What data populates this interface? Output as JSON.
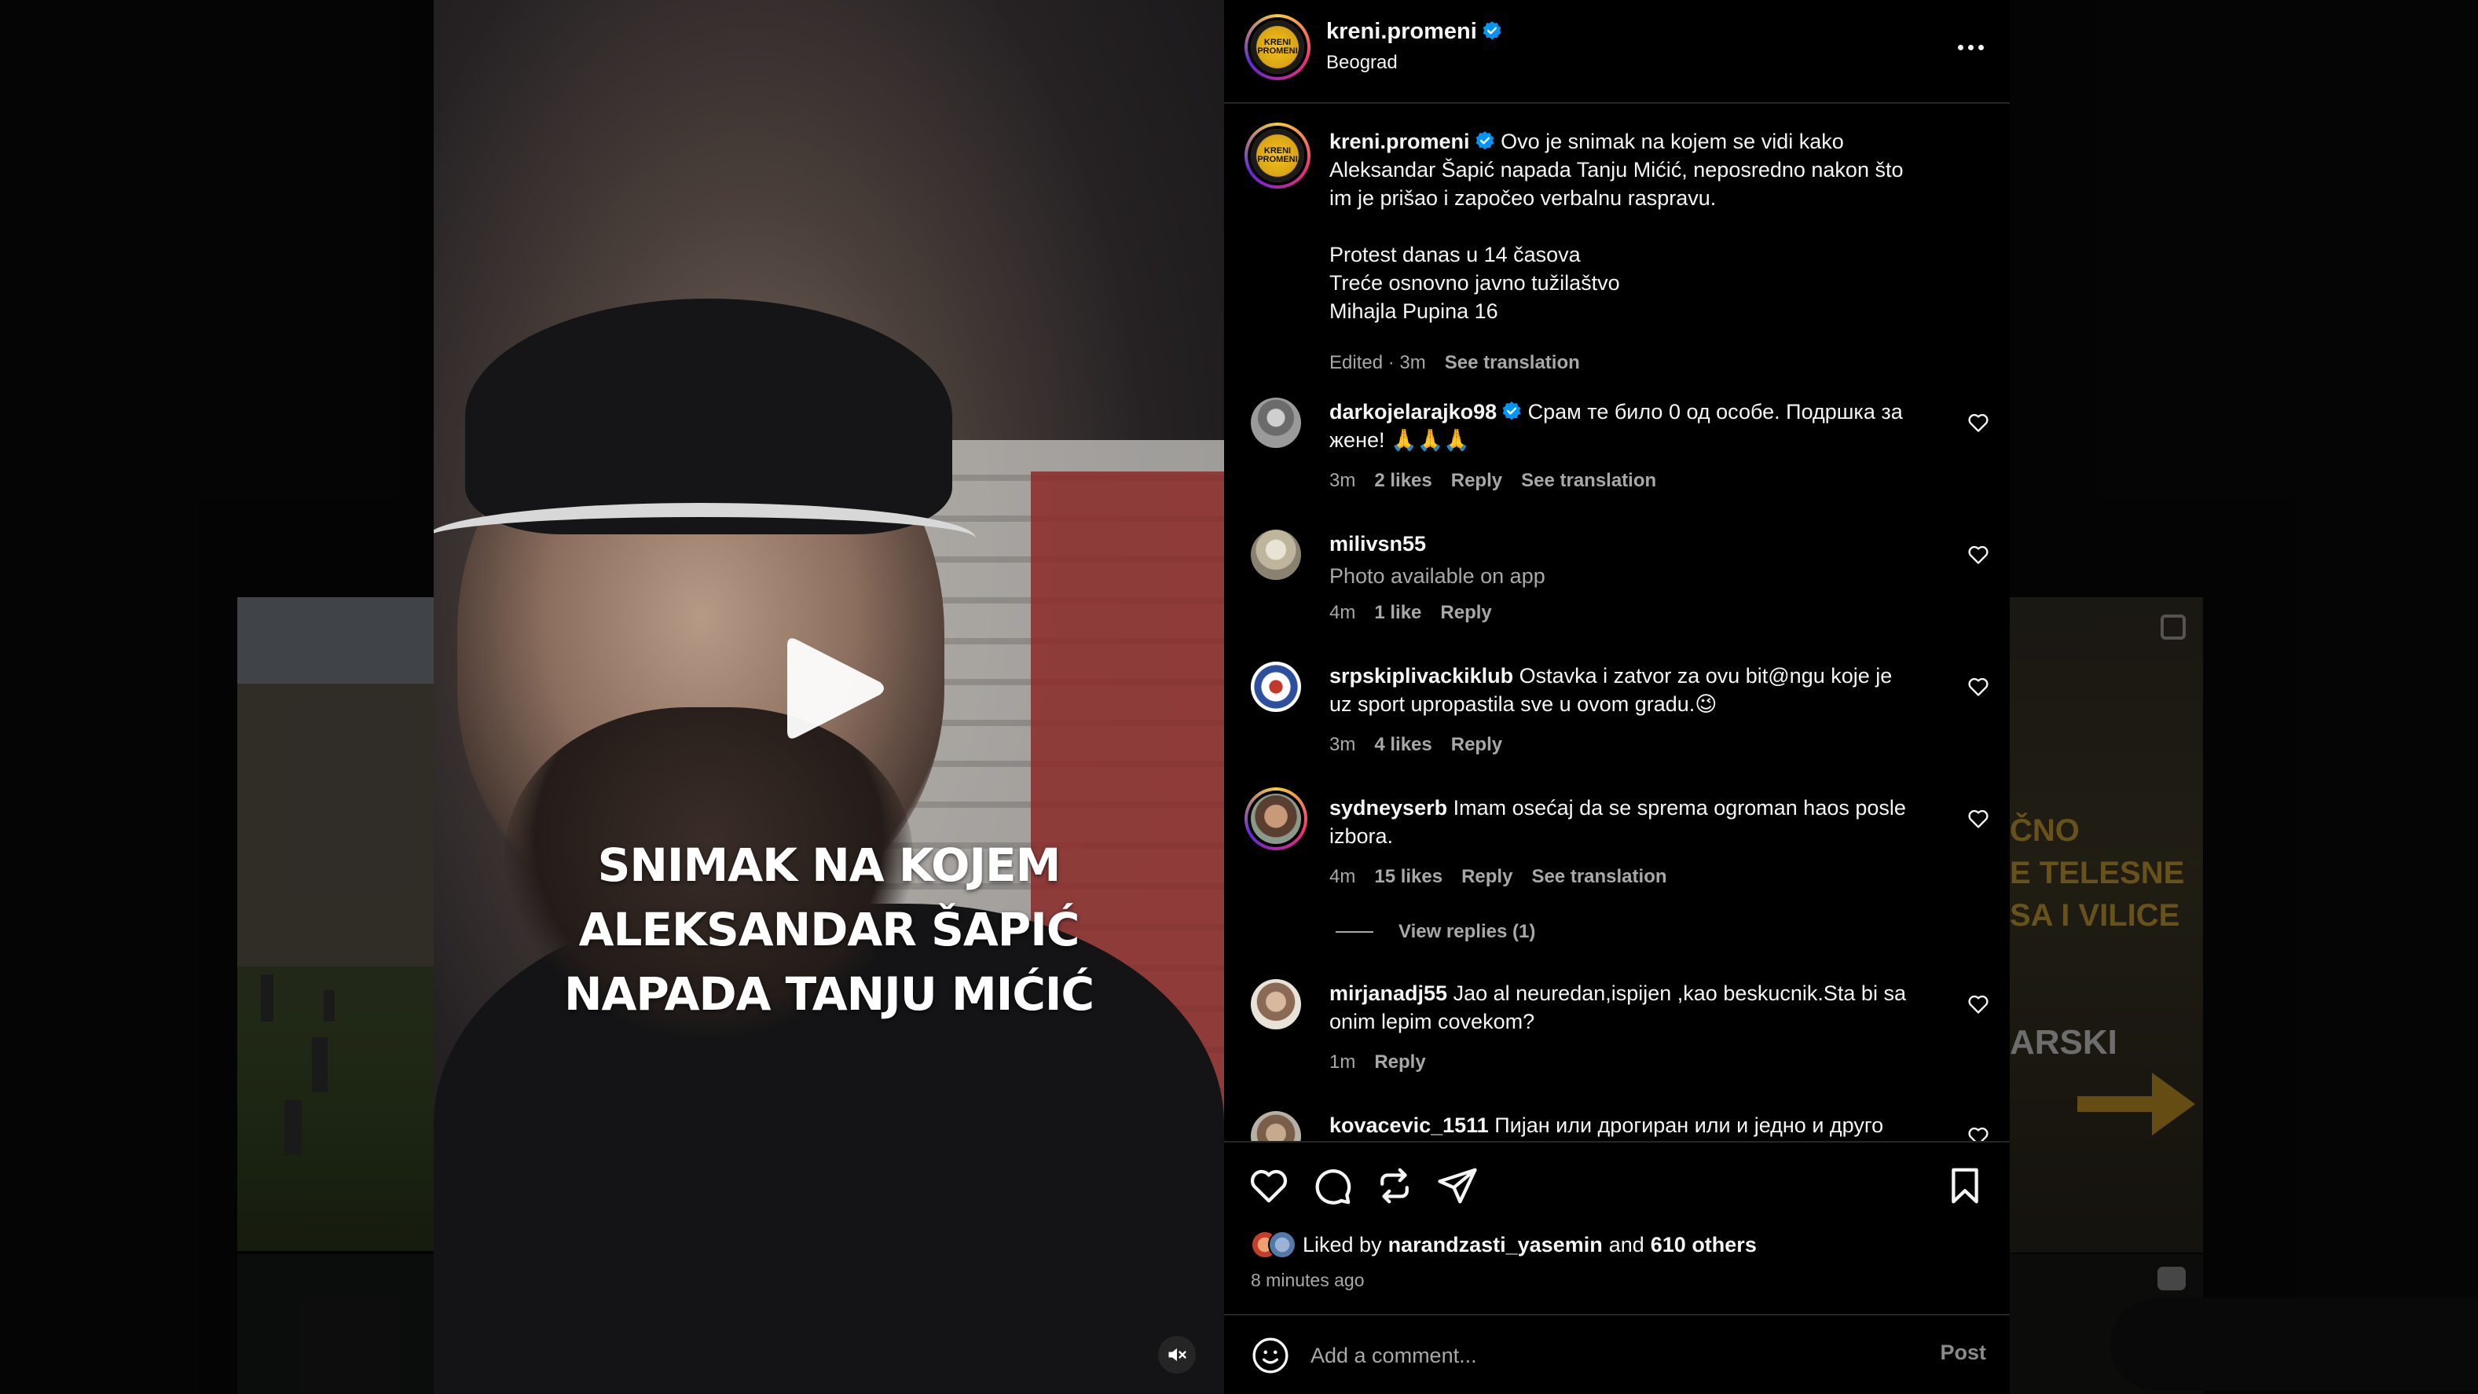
{
  "post": {
    "username": "kreni.promeni",
    "location": "Beograd",
    "logo_text": "KRENI PROMENI",
    "caption_lines": [
      "Ovo je snimak na kojem se vidi kako",
      "Aleksandar Šapić napada Tanju Mićić, neposredno nakon što",
      "im je prišao i započeo verbalnu raspravu."
    ],
    "caption_extra": [
      "Protest danas u 14 časova",
      "Treće osnovno javno tužilaštvo",
      "Mihajla Pupina 16"
    ],
    "edited": "Edited · 3m",
    "see_translation": "See translation"
  },
  "video": {
    "overlay_text": [
      "SNIMAK NA KOJEM",
      "ALEKSANDAR ŠAPIĆ",
      "NAPADA TANJU MIĆIĆ"
    ]
  },
  "background_right": {
    "text_lines": [
      "ČNO",
      "E TELESNE",
      "SA I VILICE"
    ],
    "word": "ARSKI"
  },
  "comments": [
    {
      "user": "darkojelarajko98",
      "verified": true,
      "text_1": "Срам те било 0 од особе. Подршка за",
      "text_2": "жене! 🙏🙏🙏",
      "time": "3m",
      "likes": "2 likes",
      "reply": "Reply",
      "translate": "See translation"
    },
    {
      "user": "milivsn55",
      "verified": false,
      "text_1": "Photo available on app",
      "time": "4m",
      "likes": "1 like",
      "reply": "Reply"
    },
    {
      "user": "srpskiplivackiklub",
      "verified": false,
      "text_1": "Ostavka i zatvor za ovu bit@ngu koje je",
      "text_2": "uz sport upropastila sve u ovom gradu.😉",
      "time": "3m",
      "likes": "4 likes",
      "reply": "Reply"
    },
    {
      "user": "sydneyserb",
      "verified": false,
      "text_1": "Imam osećaj da se sprema ogroman haos posle",
      "text_2": "izbora.",
      "time": "4m",
      "likes": "15 likes",
      "reply": "Reply",
      "translate": "See translation",
      "view_replies": "View replies (1)"
    },
    {
      "user": "mirjanadj55",
      "verified": false,
      "text_1": "Jao al neuredan,ispijen ,kao beskucnik.Sta bi sa",
      "text_2": "onim lepim covekom?",
      "time": "1m",
      "reply": "Reply"
    },
    {
      "user": "kovacevic_1511",
      "verified": false,
      "text_1": "Пијан или дрогиран или и једно и друго"
    }
  ],
  "likes": {
    "prefix": "Liked by",
    "user": "narandzasti_yasemin",
    "and": "and",
    "others": "610 others",
    "time_ago": "8 minutes ago"
  },
  "composer": {
    "placeholder": "Add a comment...",
    "post_label": "Post"
  },
  "colors": {
    "verified": "#0095f6",
    "panel_bg": "#000000",
    "muted_text": "#a8a8a8",
    "divider": "#262626"
  }
}
